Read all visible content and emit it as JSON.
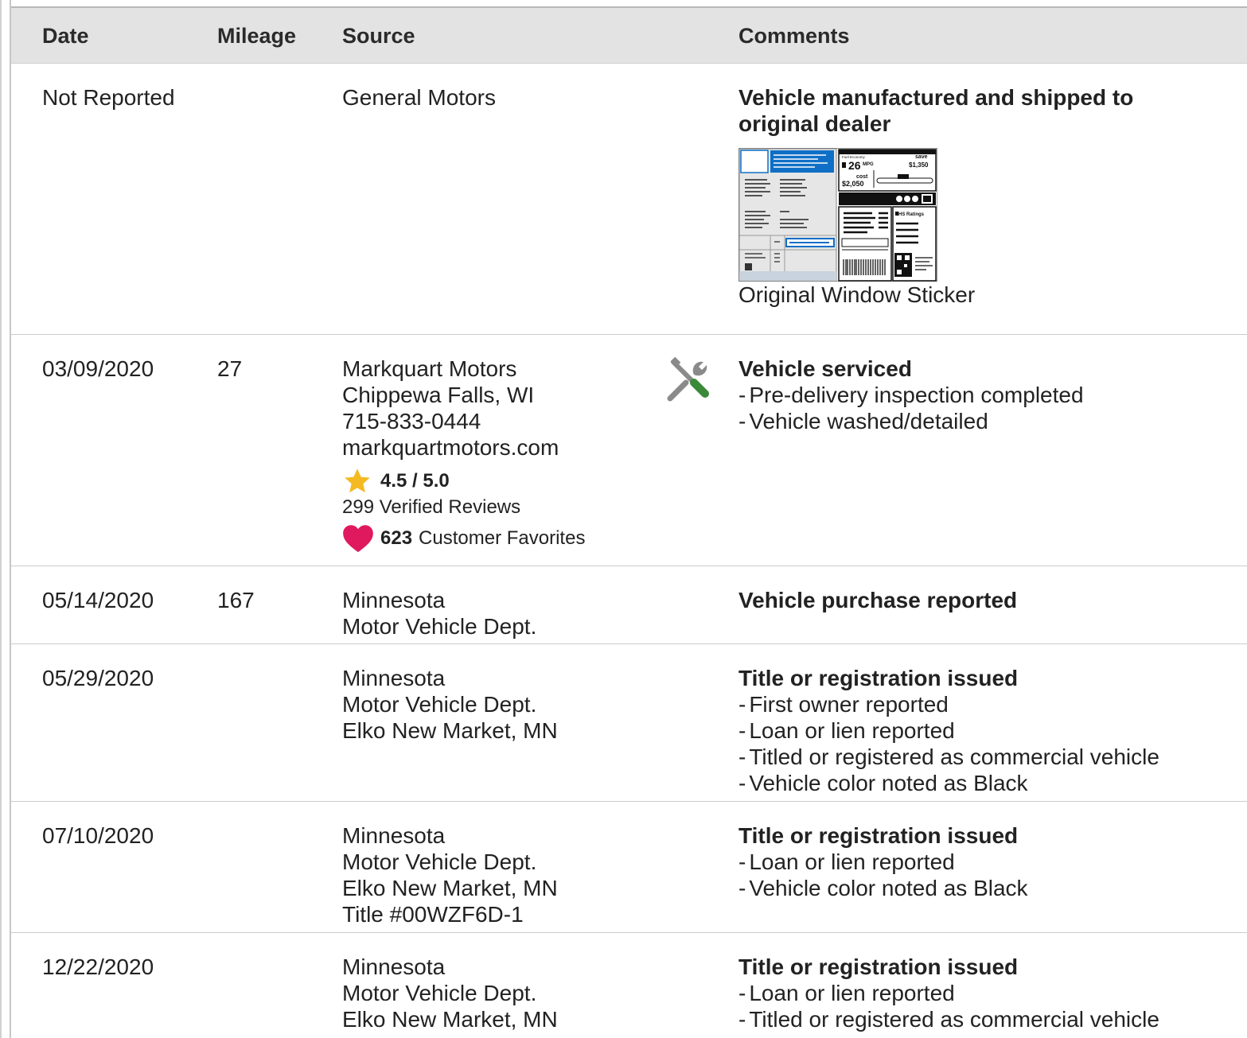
{
  "header": {
    "date": "Date",
    "mileage": "Mileage",
    "source": "Source",
    "comments": "Comments"
  },
  "rows": [
    {
      "date": "Not Reported",
      "mileage": "",
      "source": [
        "General Motors"
      ],
      "comment_title": "Vehicle manufactured and shipped to original dealer",
      "comment_items": [],
      "sticker": {
        "caption": "Original Window Sticker",
        "mpg": "26",
        "mpg_unit": "MPG",
        "save": "$1,350",
        "save_label": "save",
        "cost": "$2,050",
        "cost_label": "cost",
        "ratings_label": "HS Ratings"
      }
    },
    {
      "date": "03/09/2020",
      "mileage": "27",
      "source": [
        "Markquart Motors",
        "Chippewa Falls, WI",
        "715-833-0444",
        "markquartmotors.com"
      ],
      "rating": "4.5 / 5.0",
      "reviews": "299 Verified Reviews",
      "favorites_count": "623",
      "favorites_label": "Customer Favorites",
      "comment_icon": "wrench-service-icon",
      "comment_title": "Vehicle serviced",
      "comment_items": [
        "Pre-delivery inspection completed",
        "Vehicle washed/detailed"
      ]
    },
    {
      "date": "05/14/2020",
      "mileage": "167",
      "source": [
        "Minnesota",
        "Motor Vehicle Dept."
      ],
      "comment_title": "Vehicle purchase reported",
      "comment_items": []
    },
    {
      "date": "05/29/2020",
      "mileage": "",
      "source": [
        "Minnesota",
        "Motor Vehicle Dept.",
        "Elko New Market, MN"
      ],
      "comment_title": "Title or registration issued",
      "comment_items": [
        "First owner reported",
        "Loan or lien reported",
        "Titled or registered as commercial vehicle",
        "Vehicle color noted as Black"
      ]
    },
    {
      "date": "07/10/2020",
      "mileage": "",
      "source": [
        "Minnesota",
        "Motor Vehicle Dept.",
        "Elko New Market, MN",
        "Title #00WZF6D-1"
      ],
      "comment_title": "Title or registration issued",
      "comment_items": [
        "Loan or lien reported",
        "Vehicle color noted as Black"
      ]
    },
    {
      "date": "12/22/2020",
      "mileage": "",
      "source": [
        "Minnesota",
        "Motor Vehicle Dept.",
        "Elko New Market, MN"
      ],
      "comment_title": "Title or registration issued",
      "comment_items": [
        "Loan or lien reported",
        "Titled or registered as commercial vehicle"
      ]
    }
  ],
  "colors": {
    "header_bg": "#e3e3e3",
    "star": "#f5b921",
    "heart": "#e0195e",
    "wrench_handle": "#8a8a8a",
    "wrench_green": "#3a8a3a",
    "sticker_blue": "#0f6fc6"
  }
}
